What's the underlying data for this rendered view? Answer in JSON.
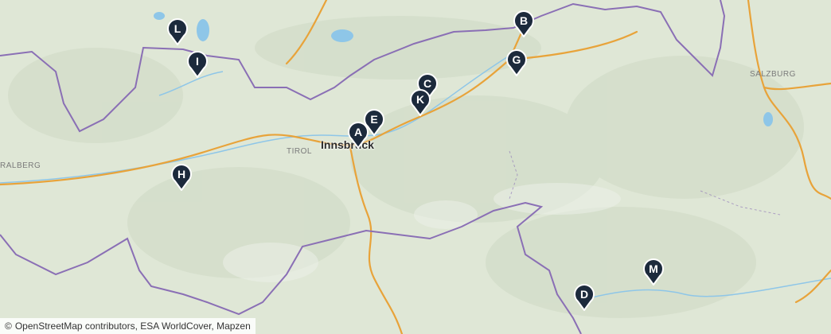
{
  "map": {
    "labels": {
      "city": "Innsbruck",
      "region_tirol": "TIROL",
      "region_salzburg": "SALZBURG",
      "region_arlberg": "RALBERG"
    },
    "markers": [
      {
        "letter": "A"
      },
      {
        "letter": "B"
      },
      {
        "letter": "C"
      },
      {
        "letter": "D"
      },
      {
        "letter": "E"
      },
      {
        "letter": "G"
      },
      {
        "letter": "H"
      },
      {
        "letter": "I"
      },
      {
        "letter": "K"
      },
      {
        "letter": "L"
      },
      {
        "letter": "M"
      }
    ],
    "marker_color": "#1c2a3c",
    "colors": {
      "terrain": "#dfe7d6",
      "border": "#8a6fb5",
      "roads": "#e8a33a",
      "water": "#8ec6e8"
    },
    "attribution": {
      "icon": "©",
      "text": "OpenStreetMap contributors, ESA WorldCover, Mapzen"
    }
  }
}
